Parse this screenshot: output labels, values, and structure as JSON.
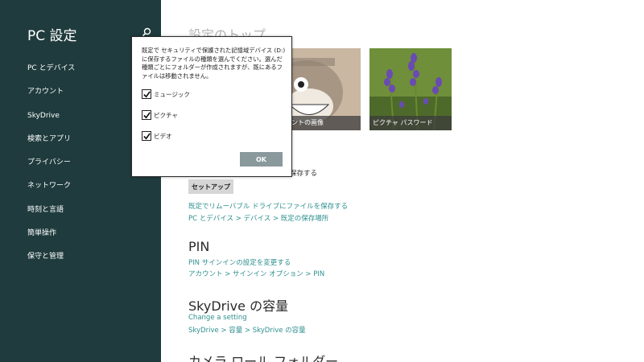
{
  "sidebar": {
    "title": "PC 設定",
    "search_icon": "search-icon",
    "items": [
      {
        "label": "PC とデバイス"
      },
      {
        "label": "アカウント"
      },
      {
        "label": "SkyDrive"
      },
      {
        "label": "検索とアプリ"
      },
      {
        "label": "プライバシー"
      },
      {
        "label": "ネットワーク"
      },
      {
        "label": "時刻と言語"
      },
      {
        "label": "簡単操作"
      },
      {
        "label": "保守と管理"
      }
    ],
    "bg_color": "#1f3b3d"
  },
  "main": {
    "top_heading": "設定のトップ",
    "tiles": [
      {
        "caption": "アカウントの画像"
      },
      {
        "caption": "ピクチャ パスワード"
      }
    ],
    "save_label": "保存する",
    "setup_button": "セットアップ",
    "removable_link": "既定でリムーバブル ドライブにファイルを保存する",
    "removable_crumb": "PC とデバイス > デバイス > 既定の保存場所",
    "pin": {
      "heading": "PIN",
      "link": "PIN サインインの設定を変更する",
      "crumb": "アカウント > サインイン オプション > PIN"
    },
    "skydrive": {
      "heading": "SkyDrive の容量",
      "link": "Change a setting",
      "crumb": "SkyDrive > 容量 > SkyDrive の容量"
    },
    "camera_heading": "カメラ ロール フォルダー",
    "link_color": "#2f8f8f"
  },
  "dialog": {
    "message": "既定で セキュリティで保護された記憶域デバイス (D:) に保存するファイルの種類を選んでください。選んだ種類ごとにフォルダーが作成されますが、既にあるファイルは移動されません。",
    "options": [
      {
        "label": "ミュージック",
        "checked": true
      },
      {
        "label": "ピクチャ",
        "checked": true
      },
      {
        "label": "ビデオ",
        "checked": true
      }
    ],
    "ok_label": "OK",
    "ok_color": "#8a9a9c"
  }
}
